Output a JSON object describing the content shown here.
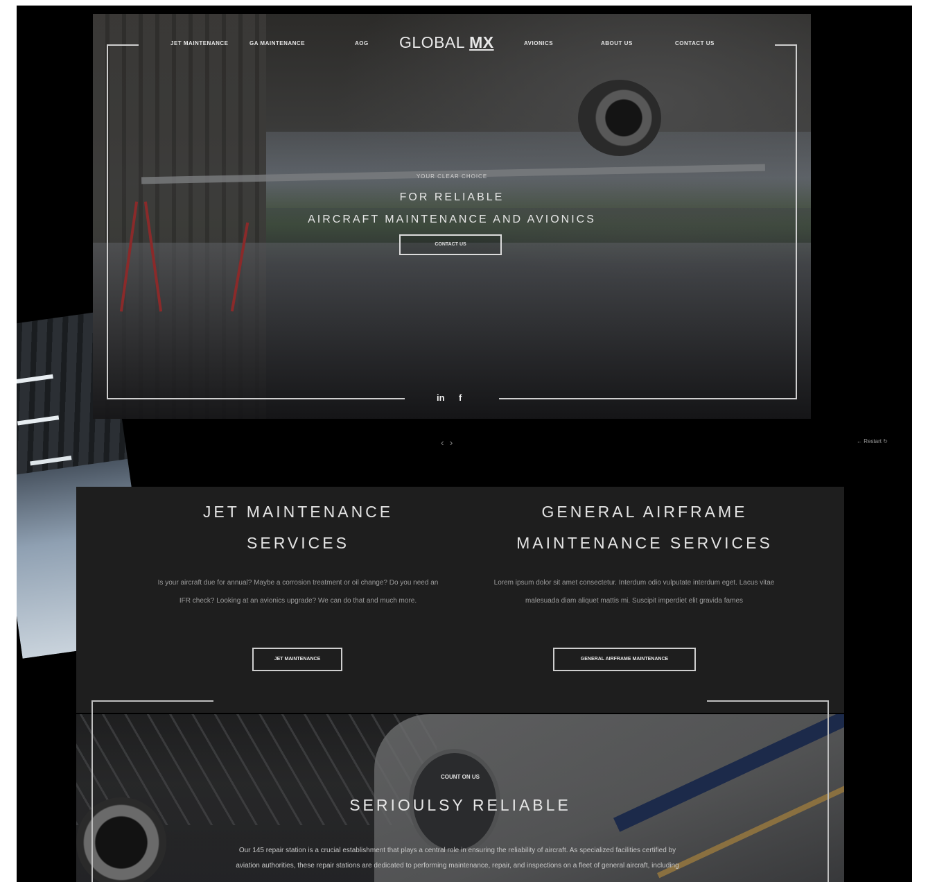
{
  "brand": {
    "logo_text": "GLOBAL",
    "logo_mx": "MX"
  },
  "nav": {
    "items": [
      "JET MAINTENANCE",
      "GA MAINTENANCE",
      "AOG",
      "AVIONICS",
      "ABOUT US",
      "CONTACT US"
    ]
  },
  "hero": {
    "kicker": "YOUR CLEAR CHOICE",
    "line1": "FOR RELIABLE",
    "line2": "AIRCRAFT MAINTENANCE AND AVIONICS",
    "cta": "CONTACT US",
    "social": {
      "linkedin": "in",
      "facebook": "f"
    }
  },
  "slider": {
    "prev": "‹",
    "next": "›",
    "restart": "← Restart ↻"
  },
  "services": [
    {
      "title_1": "JET MAINTENANCE",
      "title_2": "SERVICES",
      "body": "Is your aircraft due for annual? Maybe a corrosion treatment or oil change? Do you need an IFR check? Looking at an avionics upgrade? We can do that and much more.",
      "button": "JET MAINTENANCE"
    },
    {
      "title_1": "GENERAL AIRFRAME",
      "title_2": "MAINTENANCE SERVICES",
      "body": "Lorem ipsum dolor sit amet consectetur. Interdum odio vulputate interdum eget. Lacus vitae malesuada diam aliquet mattis mi. Suscipit imperdiet elit gravida fames",
      "button": "GENERAL AIRFRAME MAINTENANCE"
    }
  ],
  "reliable": {
    "kicker": "COUNT ON US",
    "title": "SERIOULSY RELIABLE",
    "body": "Our 145 repair station is a crucial establishment that plays a central role in ensuring the reliability of aircraft. As specialized facilities certified by aviation authorities, these repair stations are dedicated to performing maintenance, repair, and inspections on a fleet of general aircraft, including"
  },
  "colors": {
    "canvas": "#000000",
    "panel": "#1e1e1e",
    "text": "#e6e6e6",
    "muted": "#9c9c9c"
  }
}
